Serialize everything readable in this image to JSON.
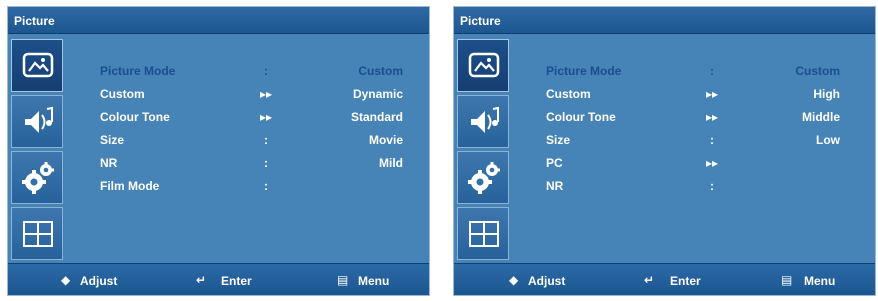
{
  "colors": {
    "panel_bg": "#4683b7",
    "title_bar": "#1f5a94",
    "highlight_text": "#1a4f8f",
    "text": "#ffffff"
  },
  "footer": {
    "adjust_icon": "up-down-diamond-icon",
    "adjust": "Adjust",
    "enter_icon": "return-arrow-icon",
    "enter": "Enter",
    "menu_icon": "menu-list-icon",
    "menu": "Menu"
  },
  "sidebar_icons": [
    "picture-icon",
    "sound-icon",
    "setup-gears-icon",
    "multi-window-icon"
  ],
  "panels": [
    {
      "title": "Picture",
      "rows": [
        {
          "label": "Picture Mode",
          "sep": ":",
          "value": "Custom"
        },
        {
          "label": "Custom",
          "sep": "▸▸",
          "value": "Dynamic"
        },
        {
          "label": "Colour Tone",
          "sep": "▸▸",
          "value": "Standard"
        },
        {
          "label": "Size",
          "sep": ":",
          "value": "Movie"
        },
        {
          "label": "NR",
          "sep": ":",
          "value": "Mild"
        },
        {
          "label": "Film Mode",
          "sep": ":",
          "value": ""
        }
      ]
    },
    {
      "title": "Picture",
      "rows": [
        {
          "label": "Picture Mode",
          "sep": ":",
          "value": "Custom"
        },
        {
          "label": "Custom",
          "sep": "▸▸",
          "value": "High"
        },
        {
          "label": "Colour Tone",
          "sep": "▸▸",
          "value": "Middle"
        },
        {
          "label": "Size",
          "sep": ":",
          "value": "Low"
        },
        {
          "label": "PC",
          "sep": "▸▸",
          "value": ""
        },
        {
          "label": "NR",
          "sep": ":",
          "value": ""
        }
      ]
    }
  ]
}
